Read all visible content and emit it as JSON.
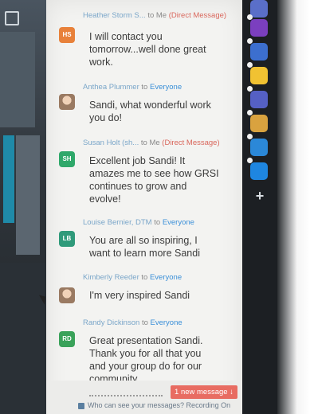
{
  "messages": [
    {
      "sender": "Heather Storm S...",
      "to_word": "to",
      "recipient": "Me",
      "tag": "(Direct Message)",
      "avatar_initials": "HS",
      "avatar_color": "#e8813a",
      "lines": [
        "I will contact you",
        "tomorrow...well done great",
        "work."
      ]
    },
    {
      "sender": "Anthea Plummer",
      "to_word": "to",
      "recipient": "Everyone",
      "tag": "",
      "avatar_initials": "",
      "avatar_color": "",
      "lines": [
        "Sandi, what wonderful work",
        "you do!"
      ]
    },
    {
      "sender": "Susan Holt (sh...",
      "to_word": "to",
      "recipient": "Me",
      "tag": "(Direct Message)",
      "avatar_initials": "SH",
      "avatar_color": "#2fa86a",
      "lines": [
        "Excellent job Sandi!  It",
        "amazes me to see how GRSI",
        "continues to grow and",
        "evolve!"
      ]
    },
    {
      "sender": "Louise Bernier, DTM",
      "to_word": "to",
      "recipient": "Everyone",
      "tag": "",
      "avatar_initials": "LB",
      "avatar_color": "#2f9a7a",
      "lines": [
        "You are all so inspiring, I",
        "want to learn more Sandi"
      ]
    },
    {
      "sender": "Kimberly Reeder",
      "to_word": "to",
      "recipient": "Everyone",
      "tag": "",
      "avatar_initials": "",
      "avatar_color": "",
      "lines": [
        "I'm very inspired Sandi"
      ]
    },
    {
      "sender": "Randy Dickinson",
      "to_word": "to",
      "recipient": "Everyone",
      "tag": "",
      "avatar_initials": "RD",
      "avatar_color": "#3aa25a",
      "lines": [
        "Great presentation Sandi.",
        "Thank you for all that you",
        "and your group do for our",
        "community"
      ]
    }
  ],
  "new_message_button": "1 new message ↓",
  "footer_note": "Who can see your messages? Recording On",
  "rail_apps": [
    {
      "name": "app-purple",
      "color": "#7b3fbf"
    },
    {
      "name": "app-blue",
      "color": "#3c6fcf"
    },
    {
      "name": "app-yellow",
      "color": "#f1c232"
    },
    {
      "name": "app-indigo",
      "color": "#5560c4"
    },
    {
      "name": "app-grid",
      "color": "#d9a23f"
    },
    {
      "name": "app-sync",
      "color": "#2b88d8"
    },
    {
      "name": "app-cyan",
      "color": "#1e86e0"
    }
  ],
  "add_app_symbol": "+"
}
